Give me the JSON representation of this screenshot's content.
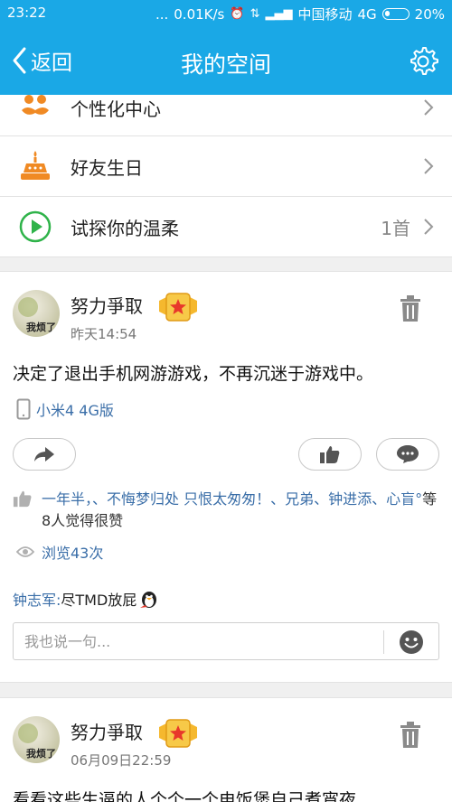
{
  "status_bar": {
    "time": "23:22",
    "dots": "...",
    "speed": "0.01K/s",
    "carrier": "中国移动",
    "network": "4G",
    "battery": "20%"
  },
  "header": {
    "back_label": "返回",
    "title": "我的空间",
    "accent": "#1aa8e6"
  },
  "menu": {
    "items": [
      {
        "label": "个性化中心",
        "icon": "mustache-icon",
        "extra": ""
      },
      {
        "label": "好友生日",
        "icon": "cake-icon",
        "extra": ""
      },
      {
        "label": "试探你的温柔",
        "icon": "play-icon",
        "extra": "1首"
      }
    ]
  },
  "posts": [
    {
      "user": "努力爭取",
      "avatar_text": "我烦了",
      "time": "昨天14:54",
      "content": "决定了退出手机网游游戏，不再沉迷于游戏中。",
      "device": "小米4 4G版",
      "likes_names": "一年半，、不悔梦归处 只恨太匆匆！、兄弟、钟进添、心盲°",
      "likes_suffix": "等8人觉得很赞",
      "views": "浏览43次",
      "comment_user": "钟志军:",
      "comment_text": " 尽TMD放屁",
      "reply_placeholder": "我也说一句..."
    },
    {
      "user": "努力爭取",
      "avatar_text": "我烦了",
      "time": "06月09日22:59",
      "content": "看看这些生逼的人个个一个电饭煲自己煮宵夜"
    }
  ]
}
